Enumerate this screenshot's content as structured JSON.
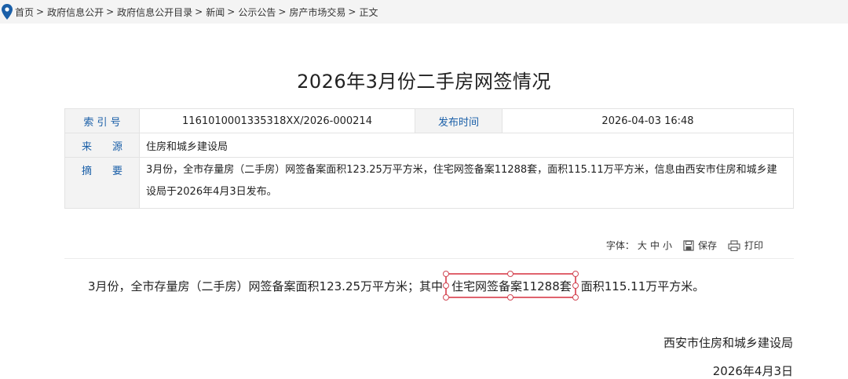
{
  "breadcrumb": {
    "items": [
      "首页",
      "政府信息公开",
      "政府信息公开目录",
      "新闻",
      "公示公告",
      "房产市场交易"
    ],
    "current": "正文",
    "separator": ">"
  },
  "article": {
    "title": "2026年3月份二手房网签情况",
    "meta": {
      "index_label": "索 引 号",
      "index_value": "1161010001335318XX/2026-000214",
      "publish_label": "发布时间",
      "publish_value": "2026-04-03 16:48",
      "source_label": "来　　源",
      "source_value": "住房和城乡建设局",
      "summary_label": "摘　　要",
      "summary_value": "3月份，全市存量房（二手房）网签备案面积123.25万平方米，住宅网签备案11288套，面积115.11万平方米，信息由西安市住房和城乡建设局于2026年4月3日发布。"
    },
    "tools": {
      "font_label": "字体：",
      "size_large": "大",
      "size_medium": "中",
      "size_small": "小",
      "save_label": "保存",
      "print_label": "打印"
    },
    "body": {
      "before": "3月份，全市存量房（二手房）网签备案面积123.25万平方米；其中",
      "highlight": "住宅网签备案11288套",
      "after": "面积115.11万平方米。"
    },
    "signature": "西安市住房和城乡建设局",
    "date": "2026年4月3日"
  },
  "colors": {
    "accent_blue": "#1a5fa8",
    "highlight_red": "#e0636e"
  }
}
